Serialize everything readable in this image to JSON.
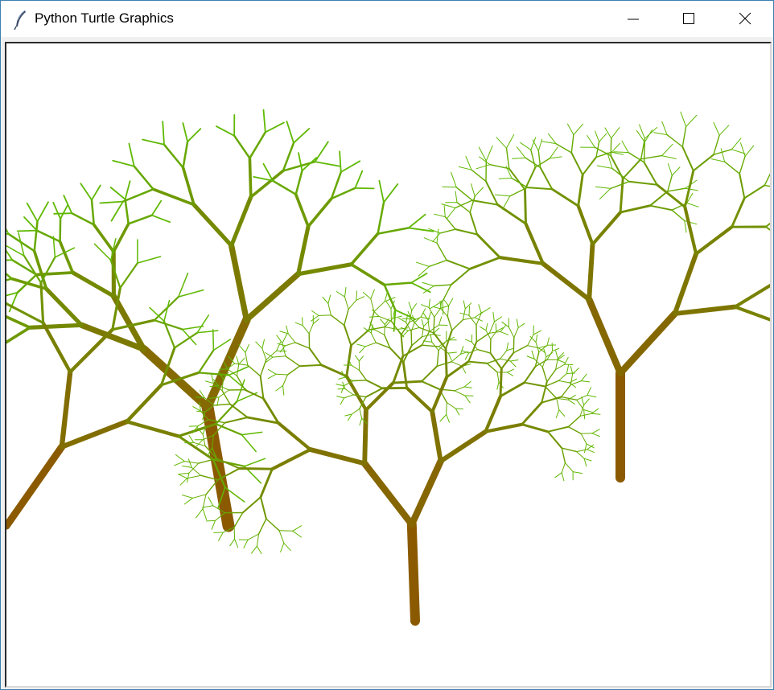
{
  "window": {
    "title": "Python Turtle Graphics",
    "icon": "feather-icon"
  },
  "controls": {
    "minimize": "minimize-icon",
    "maximize": "maximize-icon",
    "close": "close-icon"
  },
  "canvas": {
    "background": "#ffffff",
    "trunk_color": "#8b5a00",
    "leaf_color": "#5fb800",
    "drawing": "fractal-trees"
  }
}
